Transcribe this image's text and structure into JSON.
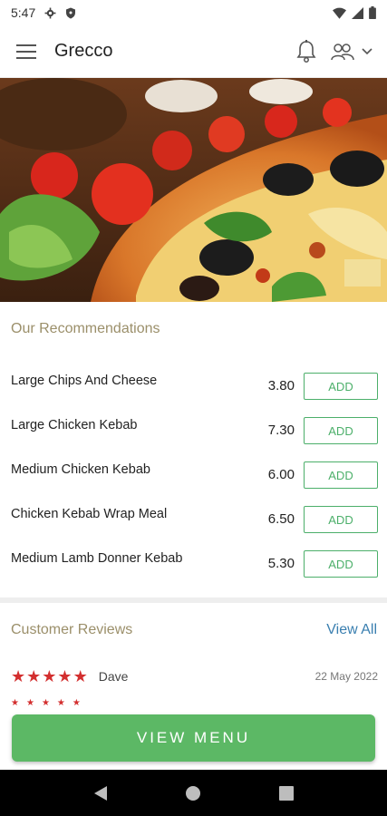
{
  "status_bar": {
    "time": "5:47"
  },
  "header": {
    "title": "Grecco"
  },
  "recommendations": {
    "title": "Our Recommendations",
    "items": [
      {
        "name": "Large Chips And Cheese",
        "price": "3.80",
        "button": "ADD"
      },
      {
        "name": "Large Chicken Kebab",
        "price": "7.30",
        "button": "ADD"
      },
      {
        "name": "Medium Chicken Kebab",
        "price": "6.00",
        "button": "ADD"
      },
      {
        "name": "Chicken Kebab Wrap Meal",
        "price": "6.50",
        "button": "ADD"
      },
      {
        "name": "Medium Lamb Donner Kebab",
        "price": "5.30",
        "button": "ADD"
      }
    ]
  },
  "reviews": {
    "title": "Customer Reviews",
    "view_all": "View All",
    "items": [
      {
        "reviewer": "Dave",
        "date": "22 May 2022",
        "rating": 5
      }
    ]
  },
  "view_menu": "VIEW MENU",
  "colors": {
    "accent_green": "#5cb865",
    "star_red": "#d32f2f",
    "link_blue": "#3a7fb0",
    "section_title": "#9b8f6a"
  },
  "icons": [
    "menu-icon",
    "bell-icon",
    "users-icon",
    "chevron-down-icon",
    "back-icon",
    "home-icon",
    "recents-icon"
  ]
}
